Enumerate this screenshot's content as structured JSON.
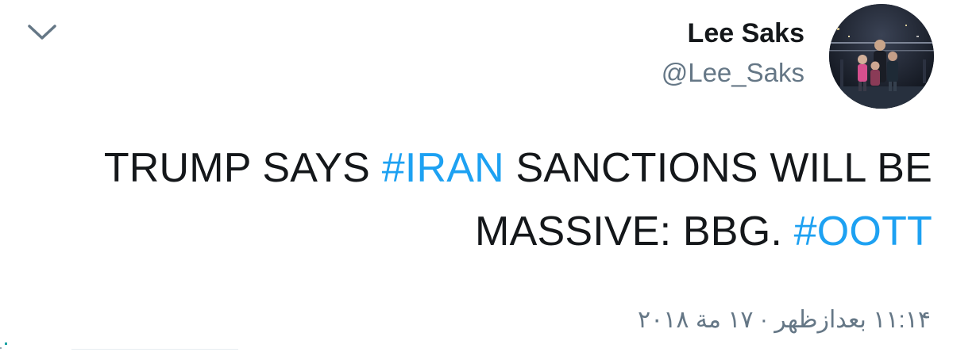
{
  "header": {
    "display_name": "Lee Saks",
    "handle": "@Lee_Saks"
  },
  "icons": {
    "menu": "chevron-down-icon"
  },
  "tweet": {
    "line1": {
      "before": "TRUMP SAYS ",
      "hashtag": "#IRAN",
      "after": " SANCTIONS WILL BE"
    },
    "line2": {
      "text": "MASSIVE: BBG.",
      "hashtag": "#OOTT"
    }
  },
  "timestamp": "١١:١۴ بعدازظهر · ١٧ مة ٢٠١٨",
  "colors": {
    "hashtag": "#1da1f2",
    "text": "#14171a",
    "secondary": "#657786"
  }
}
